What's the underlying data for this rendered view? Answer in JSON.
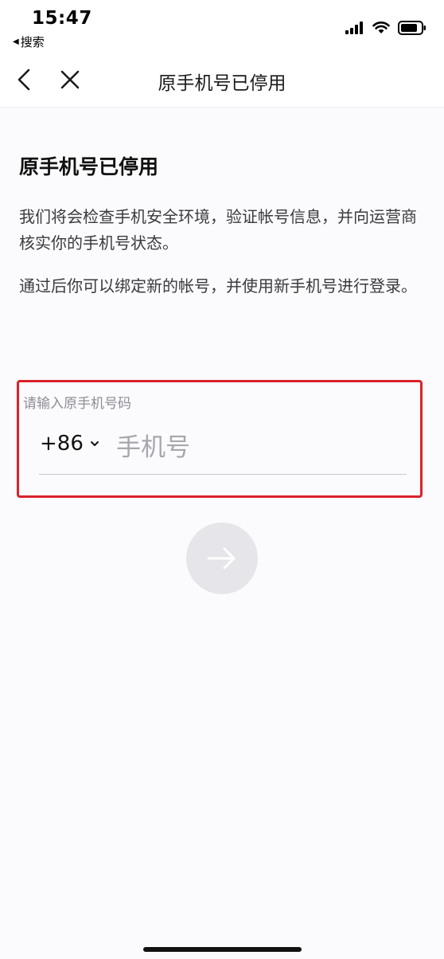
{
  "status_bar": {
    "time": "15:47",
    "back_app": "搜索",
    "back_arrow": "◀",
    "icons": [
      "cellular-signal-icon",
      "wifi-icon",
      "battery-icon"
    ]
  },
  "nav": {
    "title": "原手机号已停用",
    "icons": [
      "back-chevron-icon",
      "close-icon"
    ]
  },
  "content": {
    "title": "原手机号已停用",
    "description_1": "我们将会检查手机安全环境，验证帐号信息，并向运营商核实你的手机号状态。",
    "description_2": "通过后你可以绑定新的帐号，并使用新手机号进行登录。"
  },
  "phone_form": {
    "hint": "请输入原手机号码",
    "country_code": "+86",
    "input_value": "",
    "input_placeholder": "手机号",
    "highlight_color": "#d9232a"
  },
  "next_button": {
    "icon": "arrow-right-icon",
    "enabled": false
  }
}
